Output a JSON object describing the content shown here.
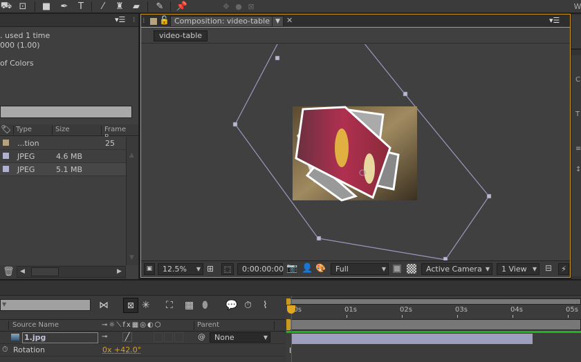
{
  "toolbar": {
    "tools": [
      "camera-orbit-tool",
      "pan-behind-tool",
      "rectangle-tool",
      "pen-tool",
      "type-tool",
      "brush-tool",
      "clone-stamp-tool",
      "eraser-tool",
      "roto-brush-tool",
      "puppet-pin-tool"
    ],
    "axis_icons": [
      "local-axis-icon",
      "world-axis-icon",
      "view-axis-icon"
    ],
    "workspace_label": "W"
  },
  "project_panel": {
    "info_lines": [
      ". used 1 time",
      "000 (1.00)",
      "",
      "of Colors"
    ],
    "columns": {
      "type": "Type",
      "size": "Size",
      "frame_rate": "Frame R..."
    },
    "rows": [
      {
        "swatch": "#b5a27e",
        "type": "...tion",
        "size": "",
        "frame_rate": "25"
      },
      {
        "swatch": "#b0b0d0",
        "type": "JPEG",
        "size": "4.6 MB",
        "frame_rate": ""
      },
      {
        "swatch": "#b0b0d0",
        "type": "JPEG",
        "size": "5.1 MB",
        "frame_rate": ""
      }
    ]
  },
  "comp_panel": {
    "tab_label": "Composition: video-table",
    "flowchart_label": "video-table",
    "zoom": "12.5%",
    "timecode": "0:00:00:00",
    "resolution": "Full",
    "camera": "Active Camera",
    "views": "1 View",
    "accent": "#d09a1a"
  },
  "timeline": {
    "columns": {
      "source_name": "Source Name",
      "parent": "Parent"
    },
    "layer": {
      "name": "1.jpg",
      "parent": "None"
    },
    "property": {
      "name": "Rotation",
      "value": "0x +42.0°"
    },
    "ticks": [
      "00s",
      "01s",
      "02s",
      "03s",
      "04s",
      "05s"
    ],
    "layer_bar_end_seconds": 4.4,
    "playhead_seconds": 0
  }
}
